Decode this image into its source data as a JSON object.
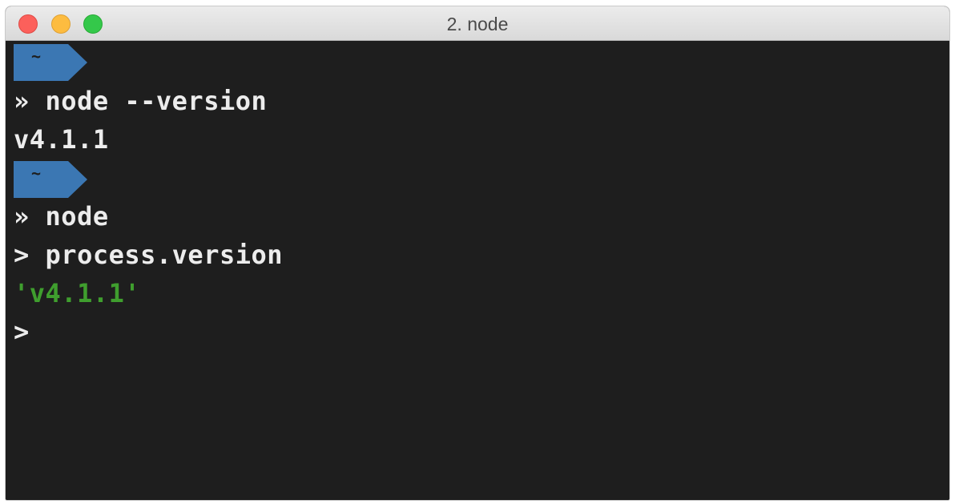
{
  "window": {
    "title": "2. node"
  },
  "colors": {
    "prompt_segment": "#3b77b3",
    "terminal_bg": "#1e1e1e",
    "text": "#ececec",
    "string_output": "#3f9e2e"
  },
  "terminal": {
    "prompt_1": {
      "dir": "~"
    },
    "cmd_1": {
      "marker": "»",
      "text": "node --version"
    },
    "out_1": "v4.1.1",
    "prompt_2": {
      "dir": "~"
    },
    "cmd_2": {
      "marker": "»",
      "text": "node"
    },
    "repl_1": {
      "marker": ">",
      "text": "process.version"
    },
    "repl_out_1": "'v4.1.1'",
    "repl_prompt": {
      "marker": ">"
    }
  }
}
